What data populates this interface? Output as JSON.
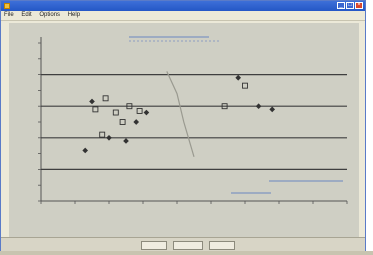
{
  "window": {
    "title": "",
    "menu": [
      "File",
      "Edit",
      "Options",
      "Help"
    ]
  },
  "chart_data": {
    "type": "scatter",
    "title": "",
    "xlabel": "",
    "ylabel": "",
    "xlim": [
      0,
      9
    ],
    "ylim": [
      0,
      10
    ],
    "hlines": [
      2,
      4,
      6,
      8
    ],
    "grid": false,
    "points_open": [
      {
        "x": 1.6,
        "y": 5.8
      },
      {
        "x": 1.9,
        "y": 6.5
      },
      {
        "x": 2.2,
        "y": 5.6
      },
      {
        "x": 2.6,
        "y": 6.0
      },
      {
        "x": 1.8,
        "y": 4.2
      },
      {
        "x": 2.4,
        "y": 5.0
      },
      {
        "x": 2.9,
        "y": 5.7
      },
      {
        "x": 5.4,
        "y": 6.0
      },
      {
        "x": 6.0,
        "y": 7.3
      }
    ],
    "points_filled": [
      {
        "x": 1.5,
        "y": 6.3
      },
      {
        "x": 1.3,
        "y": 3.2
      },
      {
        "x": 2.0,
        "y": 4.0
      },
      {
        "x": 2.5,
        "y": 3.8
      },
      {
        "x": 2.8,
        "y": 5.0
      },
      {
        "x": 3.1,
        "y": 5.6
      },
      {
        "x": 5.8,
        "y": 7.8
      },
      {
        "x": 6.4,
        "y": 6.0
      },
      {
        "x": 6.8,
        "y": 5.8
      }
    ],
    "curve": [
      {
        "x": 3.7,
        "y": 8.2
      },
      {
        "x": 4.0,
        "y": 6.8
      },
      {
        "x": 4.2,
        "y": 5.0
      },
      {
        "x": 4.5,
        "y": 2.8
      }
    ]
  },
  "bottom_buttons": [
    "",
    "",
    ""
  ],
  "colors": {
    "plot_bg": "#cfcfc4",
    "hline": "#3f3f3f",
    "marker": "#333333",
    "annotation": "#4a6fc0"
  }
}
